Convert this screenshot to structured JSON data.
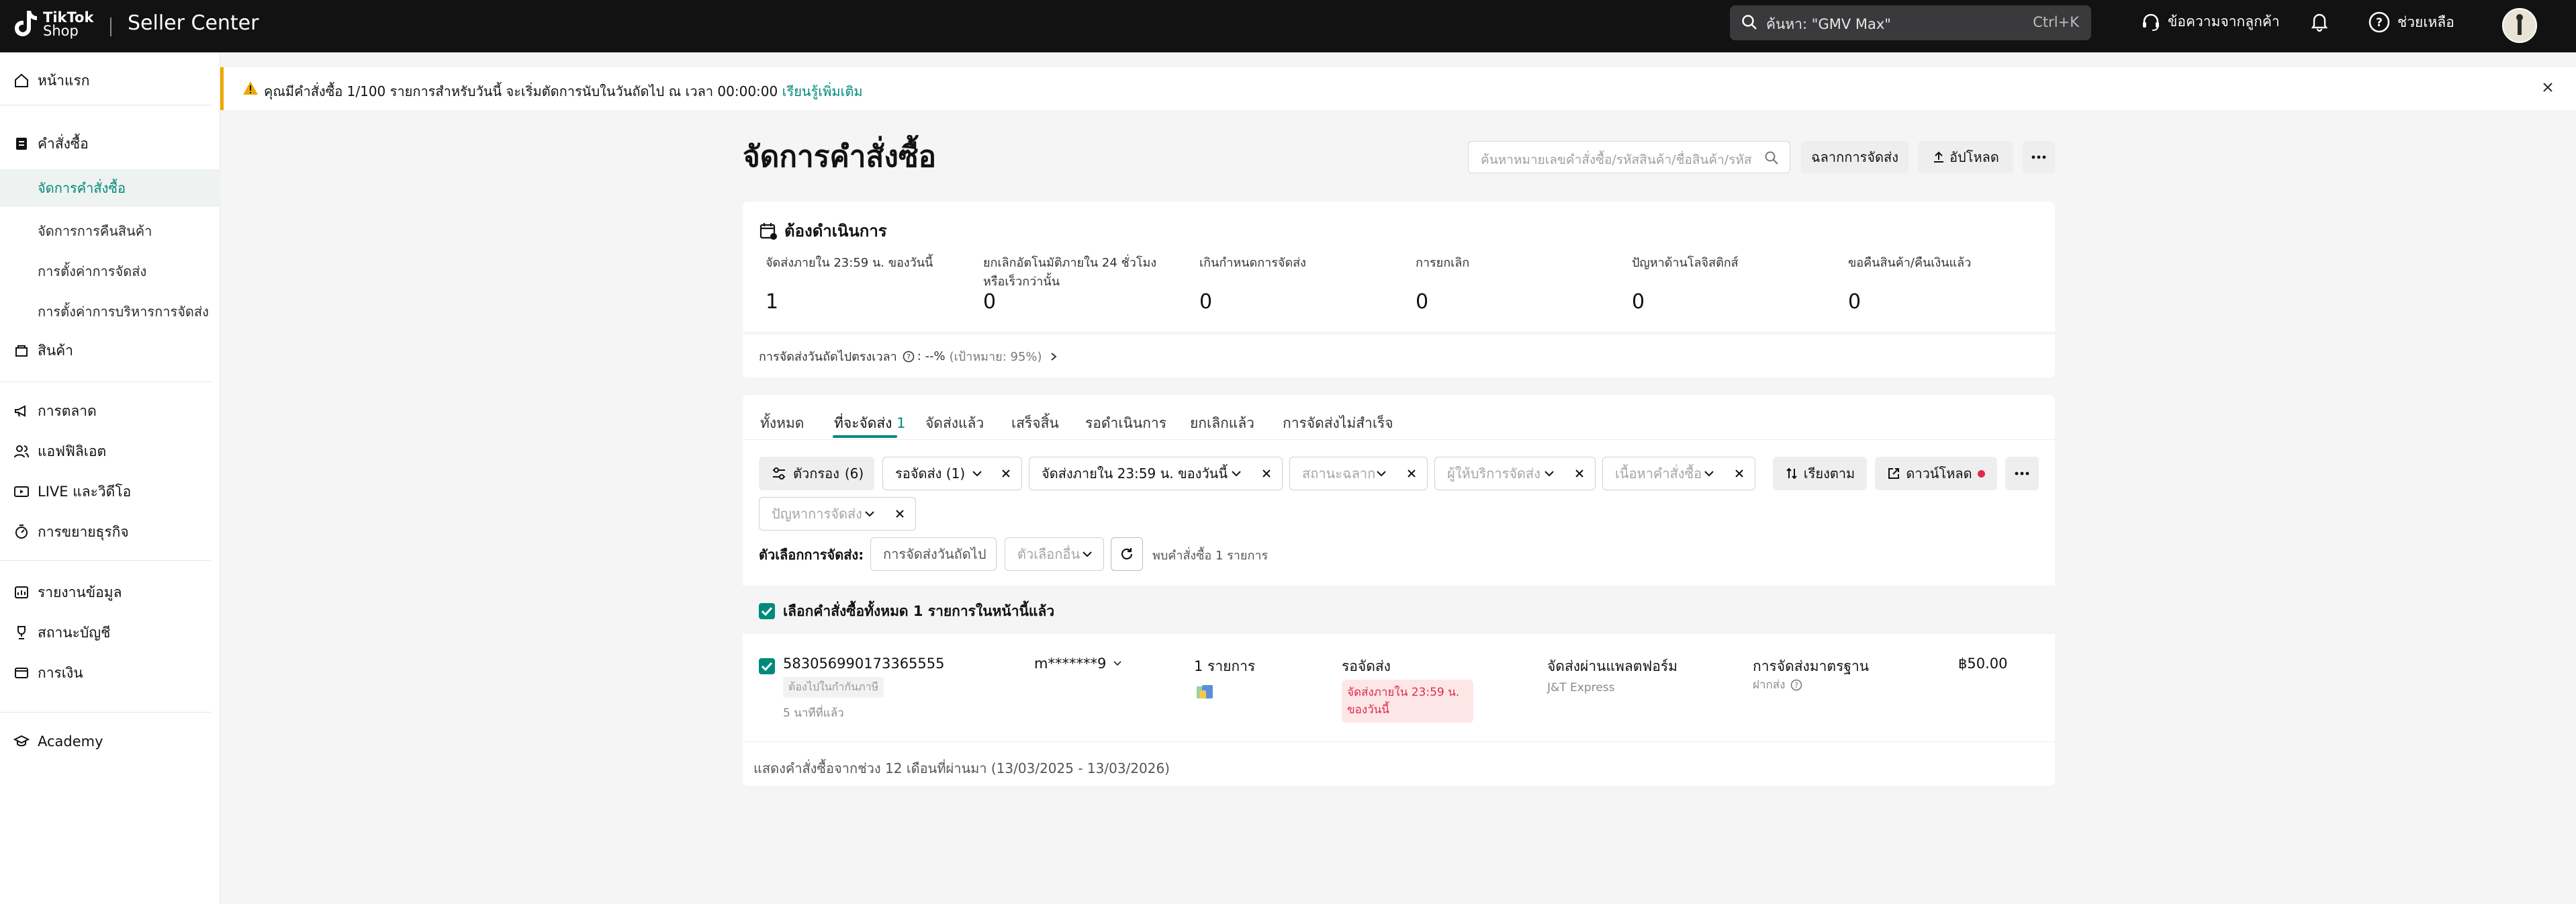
{
  "topbar": {
    "logo_text_1": "TikTok",
    "logo_text_2": "Shop",
    "seller_center": "Seller Center",
    "search_placeholder": "ค้นหา: \"GMV Max\"",
    "search_shortcut": "Ctrl+K",
    "feedback_label": "ข้อความจากลูกค้า",
    "help_label": "ช่วยเหลือ"
  },
  "sidebar": {
    "home": "หน้าแรก",
    "orders": "คำสั่งซื้อ",
    "orders_sub": [
      "จัดการคำสั่งซื้อ",
      "จัดการการคืนสินค้า",
      "การตั้งค่าการจัดส่ง",
      "การตั้งค่าการบริหารการจัดส่ง"
    ],
    "products": "สินค้า",
    "marketing": "การตลาด",
    "affiliate": "แอฟฟิลิเอต",
    "live_video": "LIVE และวิดีโอ",
    "growth": "การขยายธุรกิจ",
    "data": "รายงานข้อมูล",
    "account_health": "สถานะบัญชี",
    "finance": "การเงิน",
    "academy": "Academy"
  },
  "banner": {
    "text": "คุณมีคำสั่งซื้อ 1/100 รายการสำหรับวันนี้ จะเริ่มตัดการนับในวันถัดไป ณ เวลา 00:00:00",
    "link": "เรียนรู้เพิ่มเติม"
  },
  "header": {
    "title": "จัดการคำสั่งซื้อ",
    "search_placeholder": "ค้นหาหมายเลขคำสั่งซื้อ/รหัสสินค้า/ชื่อสินค้า/รหัส",
    "label_btn": "ฉลากการจัดส่ง",
    "upload_btn": "อัปโหลด"
  },
  "todo": {
    "title": "ต้องดำเนินการ",
    "items": [
      {
        "label": "จัดส่งภายใน 23:59 น. ของวันนี้",
        "value": "1"
      },
      {
        "label": "ยกเลิกอัตโนมัติภายใน 24 ชั่วโมง หรือเร็วกว่านั้น",
        "value": "0"
      },
      {
        "label": "เกินกำหนดการจัดส่ง",
        "value": "0"
      },
      {
        "label": "การยกเลิก",
        "value": "0"
      },
      {
        "label": "ปัญหาด้านโลจิสติกส์",
        "value": "0"
      },
      {
        "label": "ขอคืนสินค้า/คืนเงินแล้ว",
        "value": "0"
      }
    ],
    "ontime_label": "การจัดส่งวันถัดไปตรงเวลา",
    "ontime_value": ": --%",
    "ontime_target": "(เป้าหมาย: 95%)"
  },
  "tabs": {
    "all": "ทั้งหมด",
    "to_ship": "ที่จะจัดส่ง",
    "to_ship_count": "1",
    "shipped": "จัดส่งแล้ว",
    "completed": "เสร็จสิ้น",
    "pending": "รอดำเนินการ",
    "cancelled": "ยกเลิกแล้ว",
    "failed": "การจัดส่งไม่สำเร็จ"
  },
  "filters": {
    "filter_btn": "ตัวกรอง",
    "filter_count": "(6)",
    "status": "รอจัดส่ง (1)",
    "deadline": "จัดส่งภายใน 23:59 น. ของวันนี้",
    "label_status": "สถานะฉลาก",
    "carrier": "ผู้ให้บริการจัดส่ง",
    "order_content": "เนื้อหาคำสั่งซื้อ",
    "sort_btn": "เรียงตาม",
    "download_btn": "ดาวน์โหลด",
    "shipping_issue": "ปัญหาการจัดส่ง"
  },
  "ship_options": {
    "label": "ตัวเลือกการจัดส่ง:",
    "next_day": "การจัดส่งวันถัดไป",
    "other": "ตัวเลือกอื่น",
    "found": "พบคำสั่งซื้อ 1 รายการ"
  },
  "select_all": "เลือกคำสั่งซื้อทั้งหมด 1 รายการในหน้านี้แล้ว",
  "order": {
    "id": "583056990173365555",
    "tag": "ต้องไปในกำกันภาษี",
    "time_ago": "5 นาทีที่แล้ว",
    "buyer": "m*******9",
    "items": "1 รายการ",
    "status": "รอจัดส่ง",
    "due_line1": "จัดส่งภายใน 23:59 น.",
    "due_line2": "ของวันนี้",
    "ship_method": "จัดส่งผ่านแพลตฟอร์ม",
    "carrier": "J&T Express",
    "service": "การจัดส่งมาตรฐาน",
    "service_sub": "ฝากส่ง",
    "amount": "฿50.00"
  },
  "footer": "แสดงคำสั่งซื้อจากช่วง 12 เดือนที่ผ่านมา (13/03/2025 - 13/03/2026)",
  "colors": {
    "accent": "#008a7c",
    "danger": "#e0294a",
    "warning": "#f0a800",
    "topbar": "#121212"
  }
}
